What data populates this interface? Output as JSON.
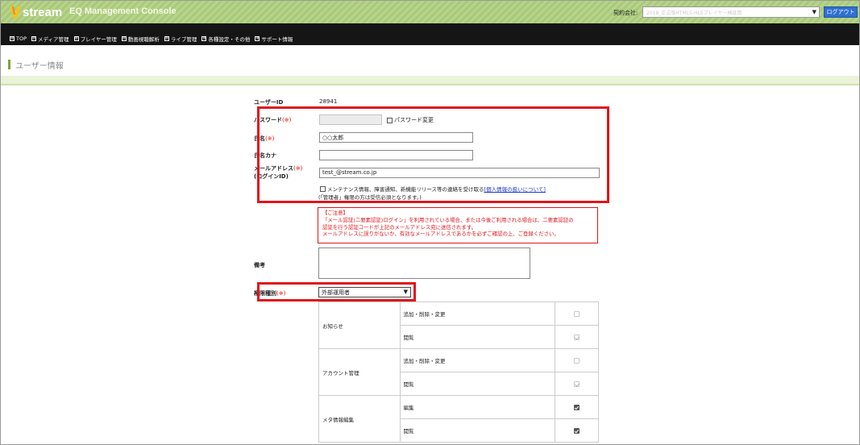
{
  "brand": {
    "logo_text": "stream",
    "console_title": "EQ Management Console"
  },
  "header": {
    "contract_label": "契約会社:",
    "contract_value": "2018_正式版HTML5-HLSプレイヤー検証用",
    "logout_label": "ログアウト"
  },
  "nav": {
    "items": [
      "TOP",
      "メディア管理",
      "プレイヤー管理",
      "動画視聴解析",
      "ライブ管理",
      "各種設定・その他",
      "サポート情報"
    ]
  },
  "page_title": "ユーザー情報",
  "form": {
    "user_id_label": "ユーザーID",
    "user_id_value": "28941",
    "password_label": "パスワード",
    "required_mark": "(※)",
    "password_change_label": "パスワード変更",
    "name_label": "氏名",
    "name_value": "○○太郎",
    "name_kana_label": "氏名カナ",
    "name_kana_value": "",
    "email_label": "メールアドレス",
    "email_sublabel": "(ログインID)",
    "email_value": "test_@stream.co.jp",
    "notify_text": "メンテナンス情報、障害通知、新機能リリース等の連絡を受け取る",
    "privacy_link": "[個人情報の扱いについて]",
    "admin_note": "(「管理者」権限の方は受信必須となります。)",
    "notice": {
      "title": "【ご注意】",
      "line1": "「メール認証(二要素認証)ログイン」を利用されている場合、または今後ご利用される場合は、二要素認証の",
      "line2": "認証を行う認証コードが上記のメールアドレス宛に送信されます。",
      "line3": "メールアドレスに誤りがないか、有効なメールアドレスであるかを必ずご確認の上、ご登録ください。"
    },
    "remarks_label": "備考",
    "remarks_value": "",
    "role_label": "権限種別",
    "role_value": "外部運用者"
  },
  "permissions": [
    {
      "category": "お知らせ",
      "actions": [
        {
          "label": "追加・削除・変更",
          "state": "off"
        },
        {
          "label": "閲覧",
          "state": "disabled-on"
        }
      ]
    },
    {
      "category": "アカウント管理",
      "actions": [
        {
          "label": "追加・削除・変更",
          "state": "off"
        },
        {
          "label": "閲覧",
          "state": "disabled-on"
        }
      ]
    },
    {
      "category": "メタ情報編集",
      "actions": [
        {
          "label": "編集",
          "state": "on"
        },
        {
          "label": "閲覧",
          "state": "on"
        }
      ]
    }
  ],
  "colors": {
    "accent_green": "#79a83a",
    "highlight_red": "#e0141b",
    "logout_blue": "#2e6fd1"
  }
}
